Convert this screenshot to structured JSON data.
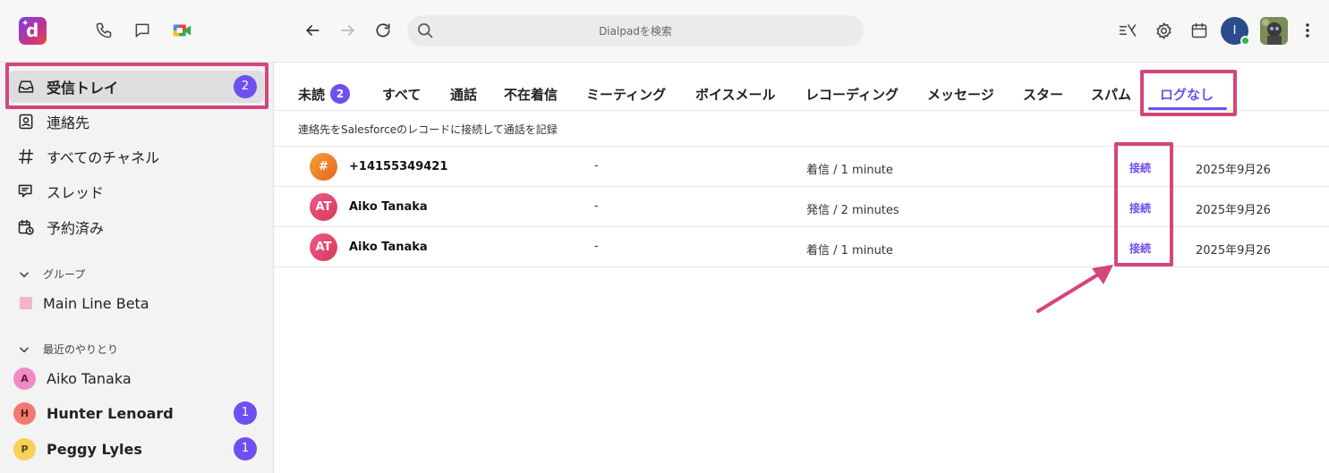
{
  "search": {
    "placeholder": "Dialpadを検索"
  },
  "user": {
    "initial": "I"
  },
  "sidebar": {
    "items": [
      {
        "label": "受信トレイ",
        "badge": "2"
      },
      {
        "label": "連絡先"
      },
      {
        "label": "すべてのチャネル"
      },
      {
        "label": "スレッド"
      },
      {
        "label": "予約済み"
      }
    ],
    "groups_header": "グループ",
    "groups": [
      {
        "label": "Main Line Beta"
      }
    ],
    "recent_header": "最近のやりとり",
    "recent": [
      {
        "initial": "A",
        "label": "Aiko Tanaka",
        "badge": ""
      },
      {
        "initial": "H",
        "label": "Hunter Lenoard",
        "badge": "1"
      },
      {
        "initial": "P",
        "label": "Peggy Lyles",
        "badge": "1"
      }
    ]
  },
  "tabs": [
    {
      "label": "未読",
      "badge": "2"
    },
    {
      "label": "すべて"
    },
    {
      "label": "通話"
    },
    {
      "label": "不在着信"
    },
    {
      "label": "ミーティング"
    },
    {
      "label": "ボイスメール"
    },
    {
      "label": "レコーディング"
    },
    {
      "label": "メッセージ"
    },
    {
      "label": "スター"
    },
    {
      "label": "スパム"
    },
    {
      "label": "ログなし"
    }
  ],
  "hint": "連絡先をSalesforceのレコードに接続して通話を記録",
  "rows": [
    {
      "avatar": "#",
      "name": "+14155349421",
      "contact": "-",
      "call": "着信 / 1 minute",
      "action": "接続",
      "date": "2025年9月26"
    },
    {
      "avatar": "AT",
      "name": "Aiko Tanaka",
      "contact": "-",
      "call": "発信 / 2 minutes",
      "action": "接続",
      "date": "2025年9月26"
    },
    {
      "avatar": "AT",
      "name": "Aiko Tanaka",
      "contact": "-",
      "call": "着信 / 1 minute",
      "action": "接続",
      "date": "2025年9月26"
    }
  ],
  "colors": {
    "accent": "#6e4ff0",
    "highlight": "#d4457d"
  }
}
